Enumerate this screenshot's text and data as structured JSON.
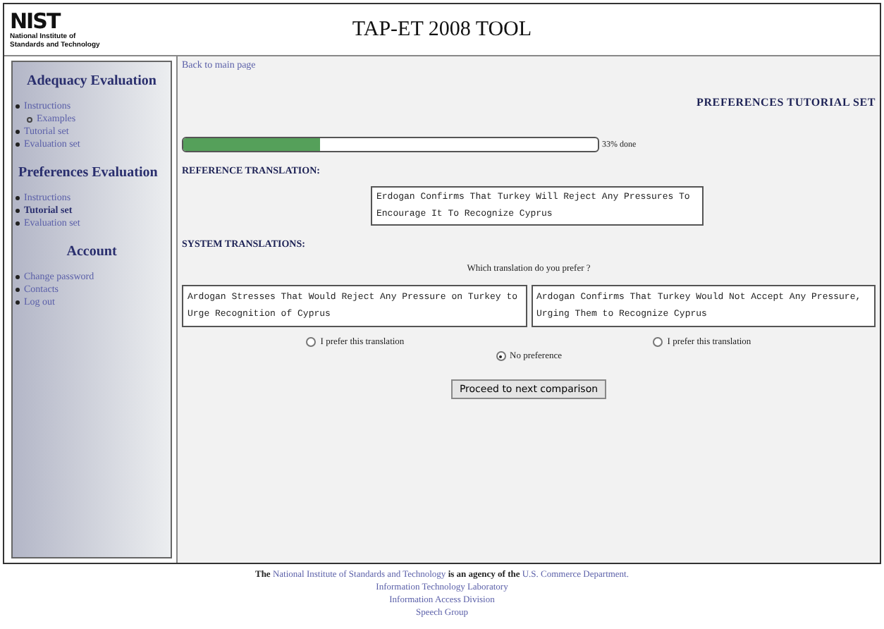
{
  "logo": {
    "mark": "NIST",
    "subtitle": "National Institute of Standards and Technology"
  },
  "title": "TAP-ET 2008 TOOL",
  "sidebar": [
    {
      "heading": "Adequacy Evaluation",
      "items": [
        {
          "label": "Instructions",
          "selected": false,
          "children": [
            {
              "label": "Examples",
              "selected": false
            }
          ]
        },
        {
          "label": "Tutorial set",
          "selected": false
        },
        {
          "label": "Evaluation set",
          "selected": false
        }
      ]
    },
    {
      "heading": "Preferences Evaluation",
      "items": [
        {
          "label": "Instructions",
          "selected": false
        },
        {
          "label": "Tutorial set",
          "selected": true
        },
        {
          "label": "Evaluation set",
          "selected": false
        }
      ]
    },
    {
      "heading": "Account",
      "items": [
        {
          "label": "Change password",
          "selected": false
        },
        {
          "label": "Contacts",
          "selected": false
        },
        {
          "label": "Log out",
          "selected": false
        }
      ]
    }
  ],
  "back_link": "Back to main page",
  "page_heading": "PREFERENCES TUTORIAL SET",
  "progress": {
    "level": 0.33,
    "reading": "33% done"
  },
  "reference": {
    "label": "REFERENCE TRANSLATION:",
    "text": "Erdogan Confirms That Turkey Will Reject Any Pressures To Encourage It To Recognize Cyprus"
  },
  "system": {
    "label": "SYSTEM TRANSLATIONS:",
    "question": "Which translation do you prefer ?",
    "translations": [
      "Ardogan Stresses That Would Reject Any Pressure on Turkey to Urge Recognition of Cyprus",
      "Ardogan Confirms That Turkey Would Not Accept Any Pressure, Urging Them to Recognize Cyprus"
    ],
    "options": [
      {
        "label": "I prefer this translation",
        "selected": false
      },
      {
        "label": "I prefer this translation",
        "selected": false
      },
      {
        "label": "No preference",
        "selected": true
      }
    ]
  },
  "button": "Proceed to next comparison",
  "footer": {
    "sentence": [
      {
        "kind": "text",
        "text": "The"
      },
      {
        "kind": "link",
        "text": "National Institute of Standards and Technology"
      },
      {
        "kind": "text",
        "text": "is an agency of the"
      },
      {
        "kind": "link",
        "text": "U.S. Commerce Department."
      }
    ],
    "lines": [
      "Information Technology Laboratory",
      "Information Access Division",
      "Speech Group"
    ]
  }
}
